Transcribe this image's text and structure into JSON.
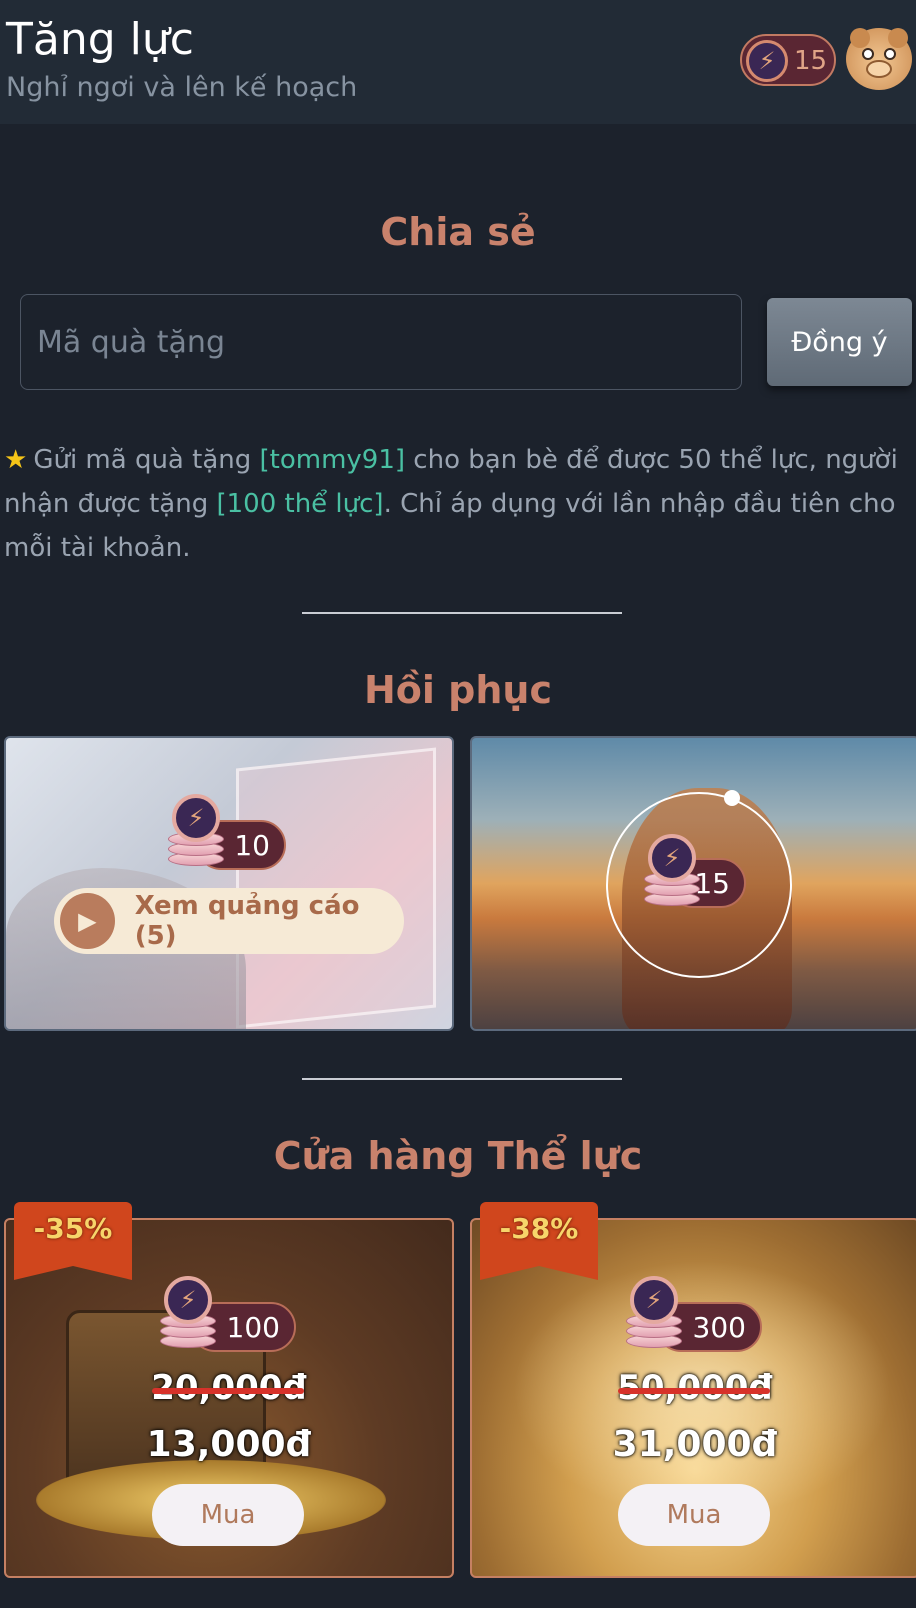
{
  "header": {
    "title": "Tăng lực",
    "subtitle": "Nghỉ ngơi và lên kế hoạch",
    "energy_count": "15",
    "energy_icon": "lightning-bolt-icon",
    "avatar_icon": "hamster-avatar"
  },
  "share": {
    "title": "Chia sẻ",
    "gift_placeholder": "Mã quà tặng",
    "agree_label": "Đồng ý",
    "info_prefix": "Gửi mã quà tặng ",
    "referral_code": "[tommy91]",
    "info_mid": " cho bạn bè để được 50 thể lực, người nhận được tặng ",
    "reward": "[100 thể lực]",
    "info_suffix": ". Chỉ áp dụng với lần nhập đầu tiên cho mỗi tài khoản."
  },
  "recover": {
    "title": "Hồi phục",
    "ad_card": {
      "amount": "10",
      "button_label": "Xem quảng cáo (5)"
    },
    "rest_card": {
      "amount": "15"
    }
  },
  "shop": {
    "title": "Cửa hàng Thể lực",
    "items": [
      {
        "discount": "-35%",
        "amount": "100",
        "old_price": "20,000đ",
        "new_price": "13,000đ",
        "buy_label": "Mua"
      },
      {
        "discount": "-38%",
        "amount": "300",
        "old_price": "50,000đ",
        "new_price": "31,000đ",
        "buy_label": "Mua"
      }
    ]
  },
  "colors": {
    "background": "#1c222c",
    "header_bg": "#222b36",
    "section_title": "#c9826c",
    "highlight": "#4ac0a3",
    "energy_pill": "#5a2633"
  }
}
